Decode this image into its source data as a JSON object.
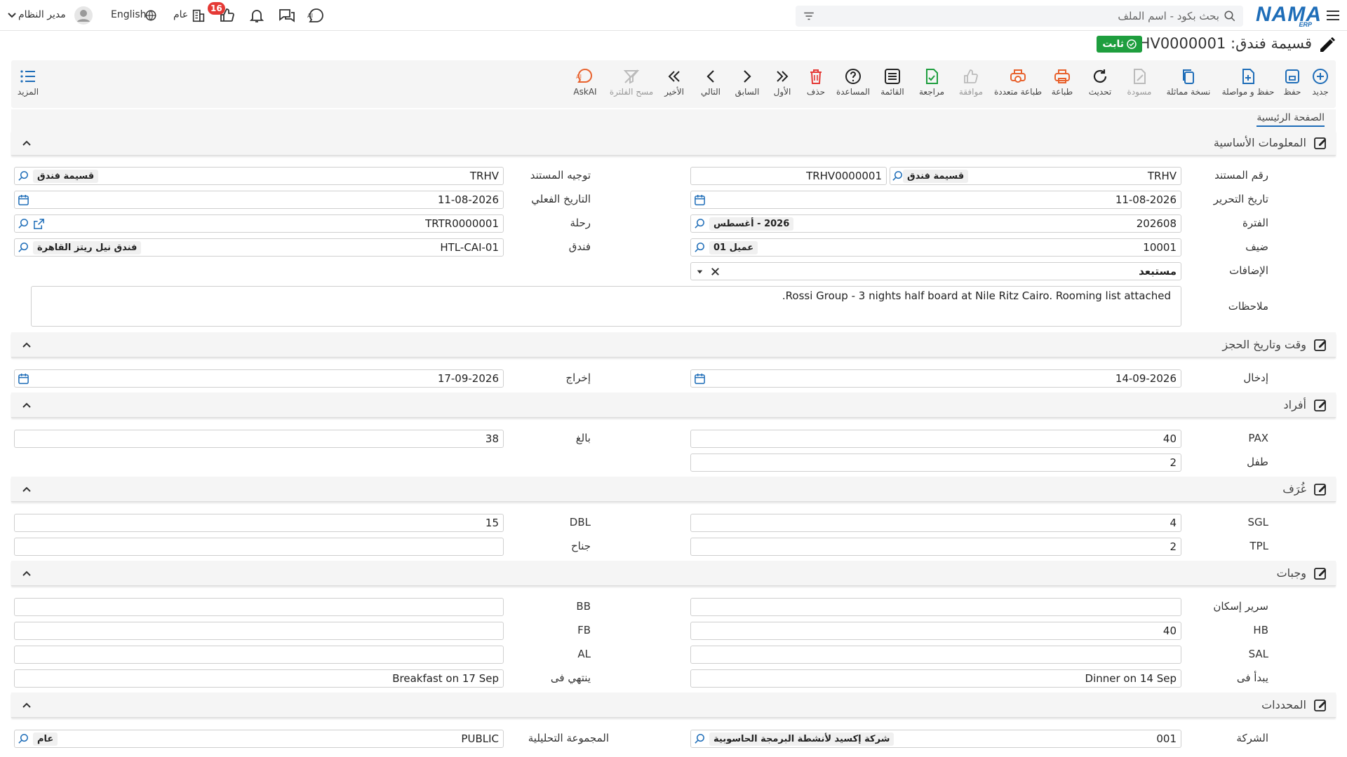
{
  "topbar": {
    "search_placeholder": "بحث بكود - اسم الملف",
    "user_name": "مدير النظام",
    "language": "English",
    "branch": "عام",
    "notification_count": "16"
  },
  "header": {
    "title": "قسيمة فندق: TRHV0000001",
    "status": "ثابت"
  },
  "toolbar": {
    "new": "جديد",
    "save": "حفظ",
    "save_continue": "حفظ و مواصلة",
    "duplicate": "نسخة مماثلة",
    "draft": "مسودة",
    "refresh": "تحديث",
    "print": "طباعة",
    "multi_print": "طباعة متعددة",
    "approve": "موافقة",
    "review": "مراجعة",
    "list": "القائمة",
    "help": "المساعدة",
    "delete": "حذف",
    "first": "الأول",
    "prev": "السابق",
    "next": "التالي",
    "last": "الأخير",
    "clear_filter": "مسح الفلترة",
    "askai": "AskAI",
    "more": "المزيد"
  },
  "tabs": {
    "main": "الصفحة الرئيسية"
  },
  "sections": {
    "basic": "المعلومات الأساسية",
    "booking": "وقت وتاريخ الحجز",
    "persons": "أفراد",
    "rooms": "غُرَف",
    "meals": "وجبات",
    "dimensions": "المحددات"
  },
  "basic": {
    "doc_no_label": "رقم المستند",
    "doc_book": "TRHV",
    "doc_book_tag": "قسيمة فندق",
    "doc_no": "TRHV0000001",
    "direction_label": "توجيه المستند",
    "direction": "TRHV",
    "direction_tag": "قسيمة فندق",
    "date_label": "تاريخ التحرير",
    "date": "11-08-2026",
    "actual_date_label": "التاريخ الفعلي",
    "actual_date": "11-08-2026",
    "period_label": "الفترة",
    "period": "202608",
    "period_tag": "2026 - أغسطس",
    "trip_label": "رحلة",
    "trip": "TRTR0000001",
    "guest_label": "ضيف",
    "guest": "10001",
    "guest_tag": "عميل 01",
    "hotel_label": "فندق",
    "hotel": "HTL-CAI-01",
    "hotel_tag": "فندق نيل ريتز القاهرة",
    "additions_label": "الإضافات",
    "additions": "مستبعد",
    "notes_label": "ملاحظات",
    "notes": "Rossi Group - 3 nights half board at Nile Ritz Cairo. Rooming list attached."
  },
  "booking": {
    "checkin_label": "إدخال",
    "checkin": "14-09-2026",
    "checkout_label": "إخراج",
    "checkout": "17-09-2026"
  },
  "persons": {
    "pax_label": "PAX",
    "pax": "40",
    "adult_label": "بالغ",
    "adult": "38",
    "child_label": "طفل",
    "child": "2"
  },
  "rooms": {
    "sgl_label": "SGL",
    "sgl": "4",
    "dbl_label": "DBL",
    "dbl": "15",
    "tpl_label": "TPL",
    "tpl": "2",
    "suite_label": "جناح",
    "suite": ""
  },
  "meals": {
    "bed_label": "سرير إسكان",
    "bed": "",
    "bb_label": "BB",
    "bb": "",
    "hb_label": "HB",
    "hb": "40",
    "fb_label": "FB",
    "fb": "",
    "sal_label": "SAL",
    "sal": "",
    "al_label": "AL",
    "al": "",
    "starts_label": "يبدأ فى",
    "starts": "Dinner on 14 Sep",
    "ends_label": "ينتهي فى",
    "ends": "Breakfast on 17 Sep"
  },
  "dimensions": {
    "company_label": "الشركة",
    "company": "001",
    "company_tag": "شركة إكسيد لأنشطة البرمجة الحاسوبية",
    "group_label": "المجموعة التحليلية",
    "group": "PUBLIC",
    "group_tag": "عام"
  },
  "colors": {
    "brand": "#1e6db8",
    "status": "#1e9e3e",
    "badge": "#e53935"
  }
}
